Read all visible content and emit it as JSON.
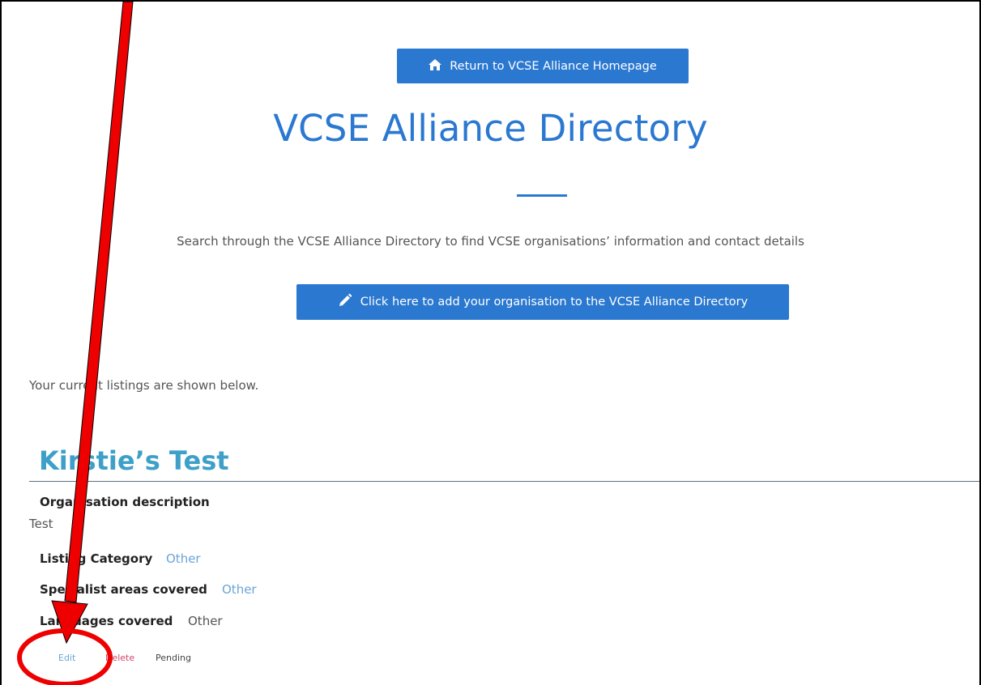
{
  "header": {
    "home_button_label": "Return to VCSE Alliance Homepage",
    "title": "VCSE Alliance Directory",
    "subtitle": "Search through the VCSE Alliance Directory to find VCSE organisations’ information and contact details",
    "add_button_label": "Click here to add your organisation to the VCSE Alliance Directory"
  },
  "listings": {
    "intro": "Your current listings are shown below.",
    "items": [
      {
        "name": "Kirstie’s Test",
        "description_label": "Organisation description",
        "description_value": "Test",
        "category_label": "Listing Category",
        "category_value": "Other",
        "specialist_label": "Specialist areas covered",
        "specialist_value": "Other",
        "languages_label": "Languages covered",
        "languages_value": "Other",
        "edit_label": "Edit",
        "delete_label": "Delete",
        "status": "Pending"
      }
    ]
  },
  "colors": {
    "accent": "#2b78d0",
    "listing_title": "#3ea0c8",
    "link": "#6aa4d8",
    "delete": "#d0456a",
    "annotation": "#ee0000"
  },
  "icons": {
    "home_button": "home-icon",
    "add_button": "pencil-icon"
  }
}
